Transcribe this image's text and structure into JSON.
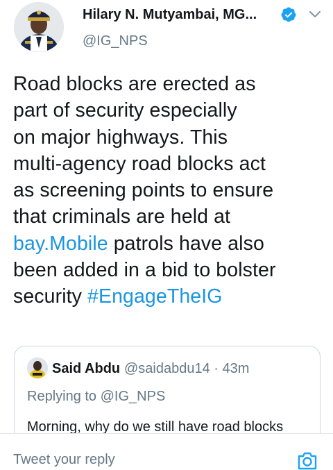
{
  "author": {
    "name": "Hilary N. Mutyambai, MG...",
    "handle": "@IG_NPS"
  },
  "tweet": {
    "lines": [
      [
        {
          "text": "Road blocks are erected as"
        }
      ],
      [
        {
          "text": "part of security especially"
        }
      ],
      [
        {
          "text": "on major highways. This"
        }
      ],
      [
        {
          "text": "multi-agency road blocks act"
        }
      ],
      [
        {
          "text": "as screening points to ensure"
        }
      ],
      [
        {
          "text": "that criminals are held at"
        }
      ],
      [
        {
          "text": "bay.Mobile",
          "link": true
        },
        {
          "text": " patrols have also"
        }
      ],
      [
        {
          "text": "been added in a bid to bolster"
        }
      ],
      [
        {
          "text": "security "
        },
        {
          "text": "#EngageTheIG",
          "link": true
        }
      ]
    ]
  },
  "quoted": {
    "name": "Said Abdu",
    "meta": "@saidabdu14 · 43m",
    "replying": "Replying to @IG_NPS",
    "text": "Morning, why do we still have road blocks"
  },
  "reply_bar": {
    "placeholder": "Tweet your reply"
  },
  "icons": {
    "verified": "verified-badge-icon",
    "chevron": "chevron-down-icon",
    "camera": "camera-icon"
  },
  "colors": {
    "link": "#1b95e0",
    "verified": "#1da1f2",
    "secondary_text": "#657786",
    "border": "#ccd6dd"
  }
}
